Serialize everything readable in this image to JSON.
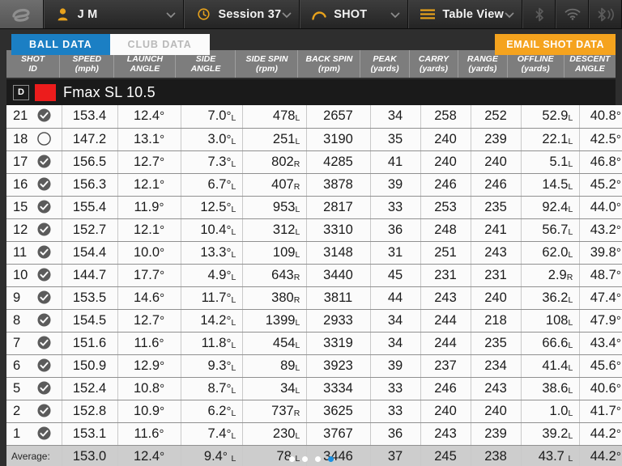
{
  "topbar": {
    "logo_icon": "foresight-swirl-logo",
    "segments": [
      {
        "icon": "user-icon",
        "label": "J M",
        "chevron": "chevron-down-icon",
        "name": "user-selector"
      },
      {
        "icon": "clock-icon",
        "label": "Session 37",
        "chevron": "chevron-down-icon",
        "name": "session-selector"
      },
      {
        "icon": "shot-arc-icon",
        "label": "SHOT",
        "chevron": "chevron-down-icon",
        "name": "shot-selector"
      },
      {
        "icon": "list-icon",
        "label": "Table View",
        "chevron": "chevron-down-icon",
        "name": "view-selector"
      }
    ],
    "status_icons": [
      "bluetooth-icon",
      "wifi-icon",
      "bluetooth-signal-icon"
    ]
  },
  "tabs": [
    {
      "label": "BALL DATA",
      "active": true
    },
    {
      "label": "CLUB DATA",
      "active": false
    }
  ],
  "actions": {
    "email_shot_data": "EMAIL SHOT DATA"
  },
  "columns": [
    {
      "line1": "SHOT",
      "line2": "ID"
    },
    {
      "line1": "SPEED",
      "line2": "(mph)"
    },
    {
      "line1": "LAUNCH",
      "line2": "ANGLE"
    },
    {
      "line1": "SIDE",
      "line2": "ANGLE"
    },
    {
      "line1": "SIDE SPIN",
      "line2": "(rpm)"
    },
    {
      "line1": "BACK SPIN",
      "line2": "(rpm)"
    },
    {
      "line1": "PEAK",
      "line2": "(yards)"
    },
    {
      "line1": "CARRY",
      "line2": "(yards)"
    },
    {
      "line1": "RANGE",
      "line2": "(yards)"
    },
    {
      "line1": "OFFLINE",
      "line2": "(yards)"
    },
    {
      "line1": "DESCENT",
      "line2": "ANGLE"
    }
  ],
  "club": {
    "badge": "D",
    "color": "#ec1c1c",
    "name": "Fmax SL 10.5"
  },
  "rows": [
    {
      "id": "21",
      "selected": true,
      "speed": "153.4",
      "launch": "12.4",
      "side": "7.0",
      "side_dir": "L",
      "sidespin": "478",
      "sidespin_dir": "L",
      "backspin": "2657",
      "peak": "34",
      "carry": "258",
      "range": "252",
      "offline": "52.9",
      "offline_dir": "L",
      "descent": "40.8"
    },
    {
      "id": "18",
      "selected": false,
      "speed": "147.2",
      "launch": "13.1",
      "side": "3.0",
      "side_dir": "L",
      "sidespin": "251",
      "sidespin_dir": "L",
      "backspin": "3190",
      "peak": "35",
      "carry": "240",
      "range": "239",
      "offline": "22.1",
      "offline_dir": "L",
      "descent": "42.5"
    },
    {
      "id": "17",
      "selected": true,
      "speed": "156.5",
      "launch": "12.7",
      "side": "7.3",
      "side_dir": "L",
      "sidespin": "802",
      "sidespin_dir": "R",
      "backspin": "4285",
      "peak": "41",
      "carry": "240",
      "range": "240",
      "offline": "5.1",
      "offline_dir": "L",
      "descent": "46.8"
    },
    {
      "id": "16",
      "selected": true,
      "speed": "156.3",
      "launch": "12.1",
      "side": "6.7",
      "side_dir": "L",
      "sidespin": "407",
      "sidespin_dir": "R",
      "backspin": "3878",
      "peak": "39",
      "carry": "246",
      "range": "246",
      "offline": "14.5",
      "offline_dir": "L",
      "descent": "45.2"
    },
    {
      "id": "15",
      "selected": true,
      "speed": "155.4",
      "launch": "11.9",
      "side": "12.5",
      "side_dir": "L",
      "sidespin": "953",
      "sidespin_dir": "L",
      "backspin": "2817",
      "peak": "33",
      "carry": "253",
      "range": "235",
      "offline": "92.4",
      "offline_dir": "L",
      "descent": "44.0"
    },
    {
      "id": "12",
      "selected": true,
      "speed": "152.7",
      "launch": "12.1",
      "side": "10.4",
      "side_dir": "L",
      "sidespin": "312",
      "sidespin_dir": "L",
      "backspin": "3310",
      "peak": "36",
      "carry": "248",
      "range": "241",
      "offline": "56.7",
      "offline_dir": "L",
      "descent": "43.2"
    },
    {
      "id": "11",
      "selected": true,
      "speed": "154.4",
      "launch": "10.0",
      "side": "13.3",
      "side_dir": "L",
      "sidespin": "109",
      "sidespin_dir": "L",
      "backspin": "3148",
      "peak": "31",
      "carry": "251",
      "range": "243",
      "offline": "62.0",
      "offline_dir": "L",
      "descent": "39.8"
    },
    {
      "id": "10",
      "selected": true,
      "speed": "144.7",
      "launch": "17.7",
      "side": "4.9",
      "side_dir": "L",
      "sidespin": "643",
      "sidespin_dir": "R",
      "backspin": "3440",
      "peak": "45",
      "carry": "231",
      "range": "231",
      "offline": "2.9",
      "offline_dir": "R",
      "descent": "48.7"
    },
    {
      "id": "9",
      "selected": true,
      "speed": "153.5",
      "launch": "14.6",
      "side": "11.7",
      "side_dir": "L",
      "sidespin": "380",
      "sidespin_dir": "R",
      "backspin": "3811",
      "peak": "44",
      "carry": "243",
      "range": "240",
      "offline": "36.2",
      "offline_dir": "L",
      "descent": "47.4"
    },
    {
      "id": "8",
      "selected": true,
      "speed": "154.5",
      "launch": "12.7",
      "side": "14.2",
      "side_dir": "L",
      "sidespin": "1399",
      "sidespin_dir": "L",
      "backspin": "2933",
      "peak": "34",
      "carry": "244",
      "range": "218",
      "offline": "108",
      "offline_dir": "L",
      "descent": "47.9"
    },
    {
      "id": "7",
      "selected": true,
      "speed": "151.6",
      "launch": "11.6",
      "side": "11.8",
      "side_dir": "L",
      "sidespin": "454",
      "sidespin_dir": "L",
      "backspin": "3319",
      "peak": "34",
      "carry": "244",
      "range": "235",
      "offline": "66.6",
      "offline_dir": "L",
      "descent": "43.4"
    },
    {
      "id": "6",
      "selected": true,
      "speed": "150.9",
      "launch": "12.9",
      "side": "9.3",
      "side_dir": "L",
      "sidespin": "89",
      "sidespin_dir": "L",
      "backspin": "3923",
      "peak": "39",
      "carry": "237",
      "range": "234",
      "offline": "41.4",
      "offline_dir": "L",
      "descent": "45.6"
    },
    {
      "id": "5",
      "selected": true,
      "speed": "152.4",
      "launch": "10.8",
      "side": "8.7",
      "side_dir": "L",
      "sidespin": "34",
      "sidespin_dir": "L",
      "backspin": "3334",
      "peak": "33",
      "carry": "246",
      "range": "243",
      "offline": "38.6",
      "offline_dir": "L",
      "descent": "40.6"
    },
    {
      "id": "2",
      "selected": true,
      "speed": "152.8",
      "launch": "10.9",
      "side": "6.2",
      "side_dir": "L",
      "sidespin": "737",
      "sidespin_dir": "R",
      "backspin": "3625",
      "peak": "33",
      "carry": "240",
      "range": "240",
      "offline": "1.0",
      "offline_dir": "L",
      "descent": "41.7"
    },
    {
      "id": "1",
      "selected": true,
      "speed": "153.1",
      "launch": "11.6",
      "side": "7.4",
      "side_dir": "L",
      "sidespin": "230",
      "sidespin_dir": "L",
      "backspin": "3767",
      "peak": "36",
      "carry": "243",
      "range": "239",
      "offline": "39.2",
      "offline_dir": "L",
      "descent": "44.2"
    }
  ],
  "average": {
    "label": "Average:",
    "speed": "153.0",
    "launch": "12.4",
    "side": "9.4",
    "side_dir": "L",
    "sidespin": "78",
    "sidespin_dir": "L",
    "backspin": "3446",
    "peak": "37",
    "carry": "245",
    "range": "238",
    "offline": "43.7",
    "offline_dir": "L",
    "descent": "44.2"
  },
  "pagination": {
    "count": 4,
    "active_index": 3
  },
  "colors": {
    "accent_blue": "#1b7fc4",
    "accent_orange": "#f5a31e",
    "club_red": "#ec1c1c",
    "dot_active": "#1b8fe0"
  }
}
